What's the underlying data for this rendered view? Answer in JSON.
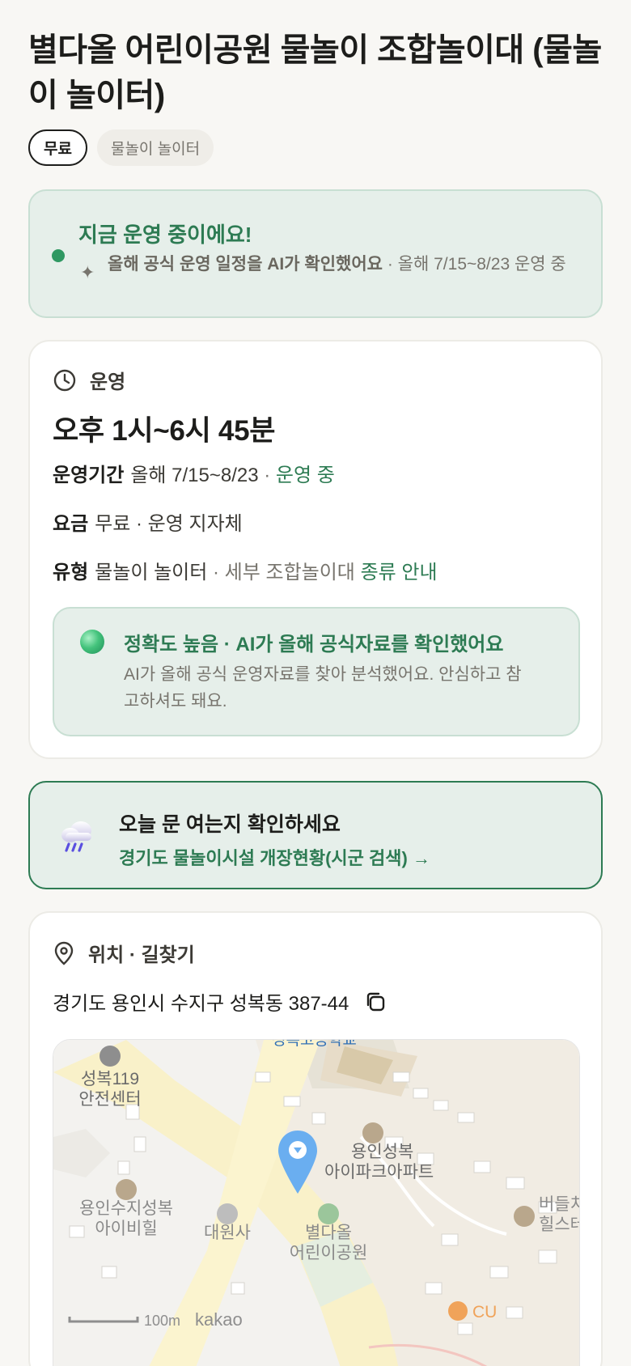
{
  "title": "별다올 어린이공원 물놀이 조합놀이대 (물놀이 놀이터)",
  "chips": [
    {
      "label": "무료"
    },
    {
      "label": "물놀이 놀이터"
    }
  ],
  "status": {
    "title": "지금 운영 중이에요!",
    "ai_note": "올해 공식 운영 일정을 AI가 확인했어요",
    "detail": " · 올해 7/15~8/23 운영 중"
  },
  "operation": {
    "section_label": "운영",
    "hours": "오후 1시~6시 45분",
    "period_key": "운영기간",
    "period_value": "올해 7/15~8/23",
    "period_sep": " · ",
    "period_status": "운영 중",
    "fee_key": "요금",
    "fee_value": "무료 · 운영 지자체",
    "type_key": "유형",
    "type_value": "물놀이 놀이터",
    "type_detail": " · 세부 조합놀이대",
    "type_link": "종류 안내",
    "accuracy_title": "정확도 높음 · AI가 올해 공식자료를 확인했어요",
    "accuracy_body": "AI가 올해 공식 운영자료를 찾아 분석했어요. 안심하고 참고하셔도 돼요."
  },
  "check": {
    "title": "오늘 문 여는지 확인하세요",
    "link": "경기도 물놀이시설 개장현황(시군 검색) →"
  },
  "location": {
    "section_label": "위치 · 길찾기",
    "address": "경기도 용인시 수지구 성복동 387-44",
    "map_labels": {
      "school": "성복고등학교",
      "fire_station_1": "성복119",
      "fire_station_2": "안전센터",
      "apt1_1": "용인성복",
      "apt1_2": "아이파크아파트",
      "apt2_1": "용인수지성복",
      "apt2_2": "아이비힐",
      "temple": "대원사",
      "park_1": "별다올",
      "park_2": "어린이공원",
      "east_1": "버들치",
      "east_2": "힐스테",
      "store": "CU",
      "scale": "100m",
      "brand": "kakao"
    }
  },
  "colors": {
    "accent_green": "#2d7b53",
    "status_bg": "#e6efea",
    "page_bg": "#f8f7f4"
  }
}
